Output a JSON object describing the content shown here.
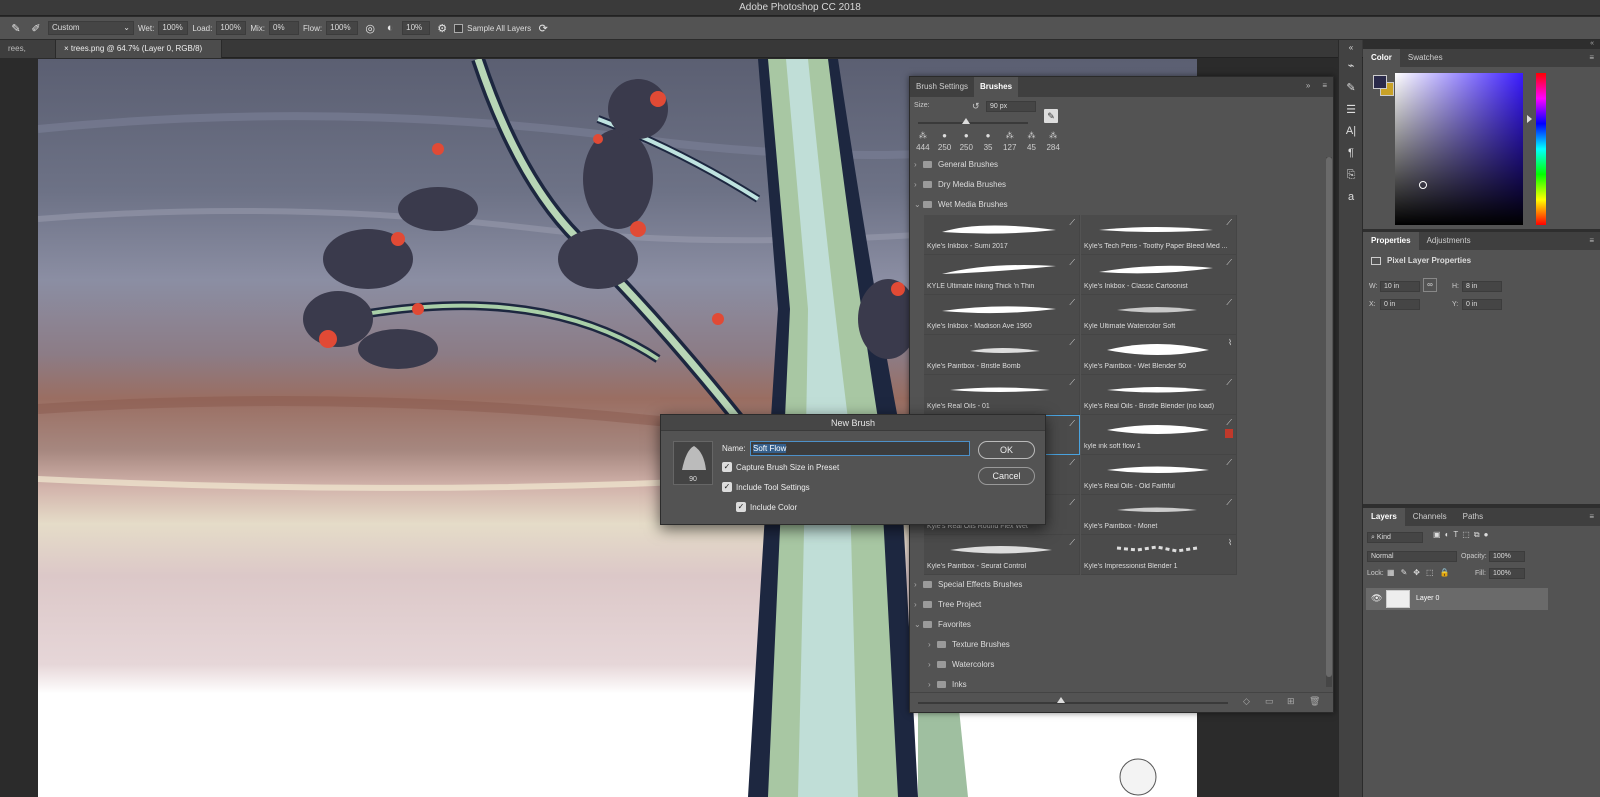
{
  "app": {
    "title": "Adobe Photoshop CC 2018"
  },
  "options_bar": {
    "preset": "Custom",
    "wet_label": "Wet:",
    "wet_value": "100%",
    "load_label": "Load:",
    "load_value": "100%",
    "mix_label": "Mix:",
    "mix_value": "0%",
    "flow_label": "Flow:",
    "flow_value": "100%",
    "smoothing_value": "10%",
    "sample_all_label": "Sample All Layers"
  },
  "doc_tabs": [
    {
      "label": "rees, RGB/8)"
    },
    {
      "label": "trees.png @ 64.7% (Layer 0, RGB/8)"
    }
  ],
  "brush_panel": {
    "tab_settings": "Brush Settings",
    "tab_brushes": "Brushes",
    "size_label": "Size:",
    "size_value": "90 px",
    "recent_sizes": [
      "444",
      "250",
      "250",
      "35",
      "127",
      "45",
      "284"
    ],
    "groups_top": [
      "General Brushes",
      "Dry Media Brushes",
      "Wet Media Brushes"
    ],
    "brushes": [
      "Kyle's Inkbox - Sumi 2017",
      "Kyle's Tech Pens - Toothy Paper Bleed Med ...",
      "KYLE Ultimate Inking Thick 'n Thin",
      "Kyle's Inkbox - Classic Cartoonist",
      "Kyle's Inkbox - Madison Ave 1960",
      "Kyle Ultimate Watercolor Soft",
      "Kyle's Paintbox - Bristle Bomb",
      "Kyle's Paintbox - Wet Blender 50",
      "Kyle's Real Oils - 01",
      "Kyle's Real Oils - Bristle Blender (no load)",
      "",
      "kyle ink soft flow 1",
      "",
      "Kyle's Real Oils - Old Faithful",
      "Kyle's Real Oils Round Flex Wet",
      "Kyle's Paintbox - Monet",
      "Kyle's Paintbox - Seurat Control",
      "Kyle's Impressionist Blender 1"
    ],
    "groups_bottom": [
      "Special Effects Brushes",
      "Tree Project",
      "Favorites"
    ],
    "favorites_children": [
      "Texture Brushes",
      "Watercolors",
      "Inks"
    ]
  },
  "dialog": {
    "title": "New Brush",
    "name_label": "Name:",
    "name_value": "Soft Flow",
    "thumb_size": "90",
    "chk_capture": "Capture Brush Size in Preset",
    "chk_tool": "Include Tool Settings",
    "chk_color": "Include Color",
    "ok": "OK",
    "cancel": "Cancel"
  },
  "color_panel": {
    "tab_color": "Color",
    "tab_swatches": "Swatches",
    "fg_color": "#2a2a4a",
    "bg_color": "#c9a227"
  },
  "properties_panel": {
    "tab_properties": "Properties",
    "tab_adjustments": "Adjustments",
    "subtitle": "Pixel Layer Properties",
    "w_label": "W:",
    "w_value": "10 in",
    "h_label": "H:",
    "h_value": "8 in",
    "x_label": "X:",
    "x_value": "0 in",
    "y_label": "Y:",
    "y_value": "0 in"
  },
  "layers_panel": {
    "tab_layers": "Layers",
    "tab_channels": "Channels",
    "tab_paths": "Paths",
    "kind": "Kind",
    "blend_mode": "Normal",
    "opacity_label": "Opacity:",
    "opacity_value": "100%",
    "lock_label": "Lock:",
    "fill_label": "Fill:",
    "fill_value": "100%",
    "layer_name": "Layer 0"
  }
}
